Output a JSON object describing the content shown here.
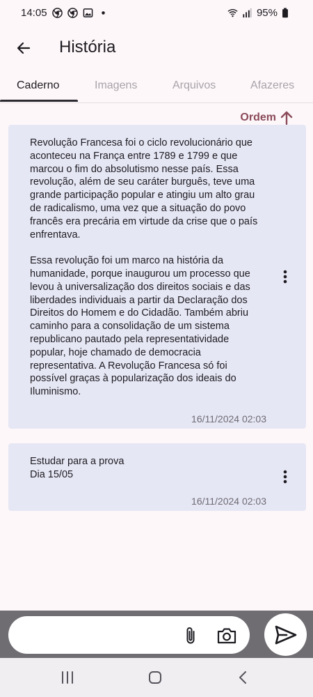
{
  "status_bar": {
    "time": "14:05",
    "battery": "95%",
    "icons": [
      "chrome-icon",
      "chrome-icon",
      "gallery-icon",
      "dot-icon",
      "wifi-icon",
      "signal-icon",
      "battery-icon"
    ]
  },
  "app_bar": {
    "title": "História"
  },
  "tabs": [
    {
      "label": "Caderno",
      "active": true
    },
    {
      "label": "Imagens",
      "active": false
    },
    {
      "label": "Arquivos",
      "active": false
    },
    {
      "label": "Afazeres",
      "active": false
    }
  ],
  "sort": {
    "label": "Ordem"
  },
  "notes": [
    {
      "paragraphs": [
        "Revolução Francesa foi o ciclo revolucionário que aconteceu na França entre 1789 e 1799 e que marcou o fim do absolutismo nesse país. Essa revolução, além de seu caráter burguês, teve uma grande participação popular e atingiu um alto grau de radicalismo, uma vez que a situação do povo francês era precária em virtude da crise que o país enfrentava.",
        "Essa revolução foi um marco na história da humanidade, porque inaugurou um processo que levou à universalização dos direitos sociais e das liberdades individuais a partir da Declaração dos Direitos do Homem e do Cidadão. Também abriu caminho para a consolidação de um sistema republicano pautado pela representatividade popular, hoje chamado de democracia representativa. A Revolução Francesa só foi possível graças à popularização dos ideais do Iluminismo."
      ],
      "date": "16/11/2024 02:03"
    },
    {
      "lines": [
        "Estudar para a prova",
        "Dia 15/05"
      ],
      "date": "16/11/2024 02:03"
    }
  ],
  "composer": {
    "value": "",
    "placeholder": ""
  },
  "colors": {
    "background": "#fdf7f9",
    "note_background": "#e6e7f5",
    "accent": "#8b4a5a",
    "composer_bar": "#6f6d72"
  }
}
